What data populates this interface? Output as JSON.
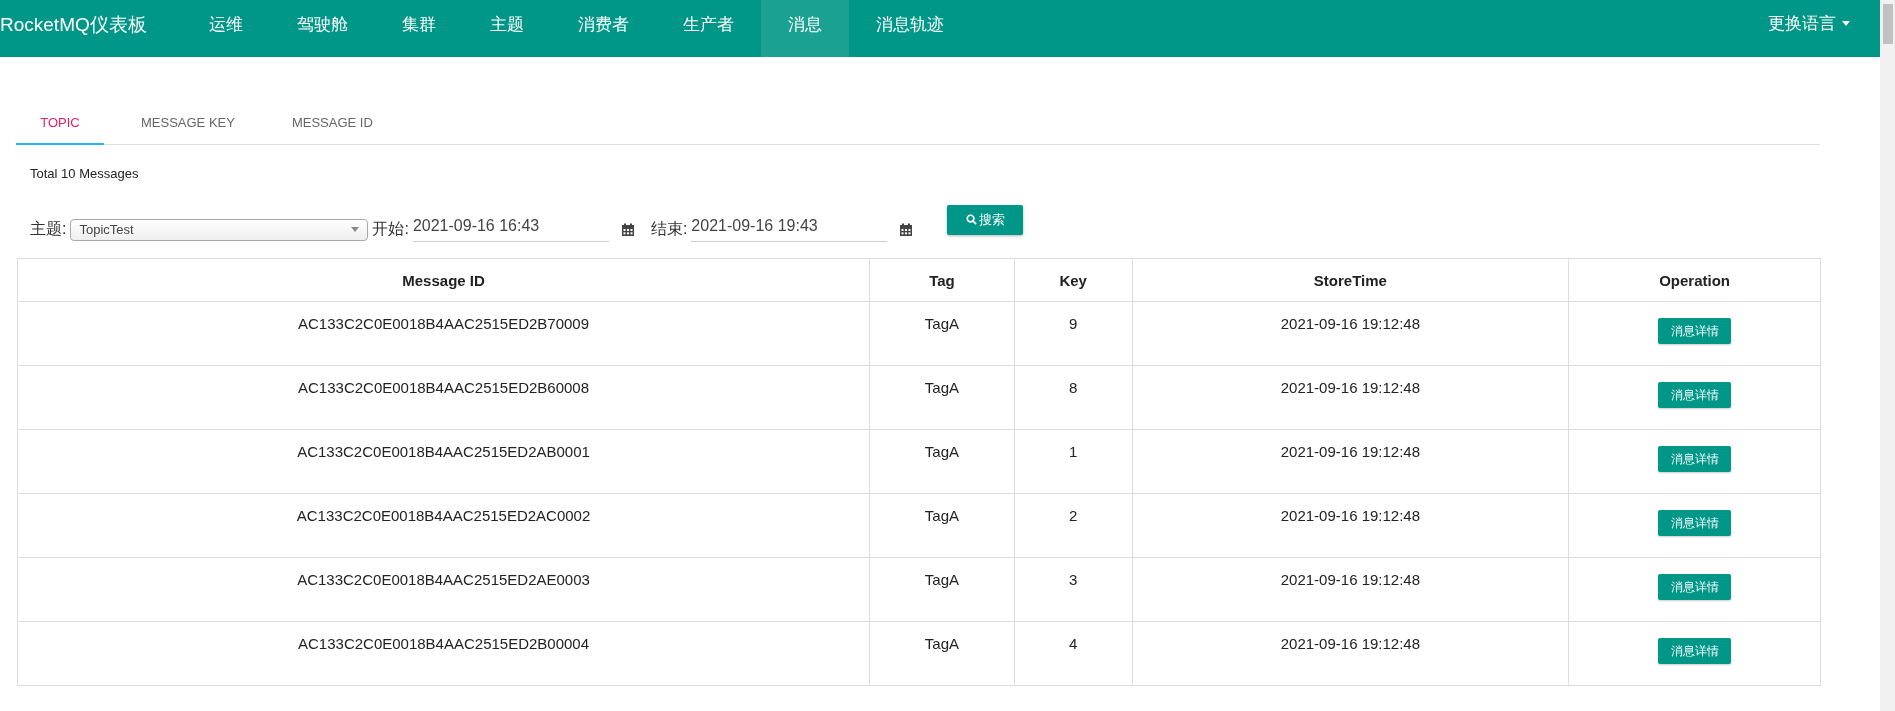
{
  "navbar": {
    "brand": "RocketMQ仪表板",
    "items": [
      {
        "label": "运维",
        "selected": false
      },
      {
        "label": "驾驶舱",
        "selected": false
      },
      {
        "label": "集群",
        "selected": false
      },
      {
        "label": "主题",
        "selected": false
      },
      {
        "label": "消费者",
        "selected": false
      },
      {
        "label": "生产者",
        "selected": false
      },
      {
        "label": "消息",
        "selected": true
      },
      {
        "label": "消息轨迹",
        "selected": false
      }
    ],
    "language_menu": "更换语言"
  },
  "tabs": [
    {
      "label": "TOPIC",
      "selected": true
    },
    {
      "label": "MESSAGE KEY",
      "selected": false
    },
    {
      "label": "MESSAGE ID",
      "selected": false
    }
  ],
  "total": "Total 10 Messages",
  "filters": {
    "topic_label": "主题:",
    "topic_value": "TopicTest",
    "start_label": "开始:",
    "start_value": "2021-09-16 16:43",
    "end_label": "结束:",
    "end_value": "2021-09-16 19:43",
    "search_button": "搜索"
  },
  "table": {
    "columns": [
      "Message ID",
      "Tag",
      "Key",
      "StoreTime",
      "Operation"
    ],
    "rows": [
      {
        "message_id": "AC133C2C0E0018B4AAC2515ED2B70009",
        "tag": "TagA",
        "key": "9",
        "store_time": "2021-09-16 19:12:48",
        "action": "消息详情"
      },
      {
        "message_id": "AC133C2C0E0018B4AAC2515ED2B60008",
        "tag": "TagA",
        "key": "8",
        "store_time": "2021-09-16 19:12:48",
        "action": "消息详情"
      },
      {
        "message_id": "AC133C2C0E0018B4AAC2515ED2AB0001",
        "tag": "TagA",
        "key": "1",
        "store_time": "2021-09-16 19:12:48",
        "action": "消息详情"
      },
      {
        "message_id": "AC133C2C0E0018B4AAC2515ED2AC0002",
        "tag": "TagA",
        "key": "2",
        "store_time": "2021-09-16 19:12:48",
        "action": "消息详情"
      },
      {
        "message_id": "AC133C2C0E0018B4AAC2515ED2AE0003",
        "tag": "TagA",
        "key": "3",
        "store_time": "2021-09-16 19:12:48",
        "action": "消息详情"
      },
      {
        "message_id": "AC133C2C0E0018B4AAC2515ED2B00004",
        "tag": "TagA",
        "key": "4",
        "store_time": "2021-09-16 19:12:48",
        "action": "消息详情"
      }
    ]
  }
}
